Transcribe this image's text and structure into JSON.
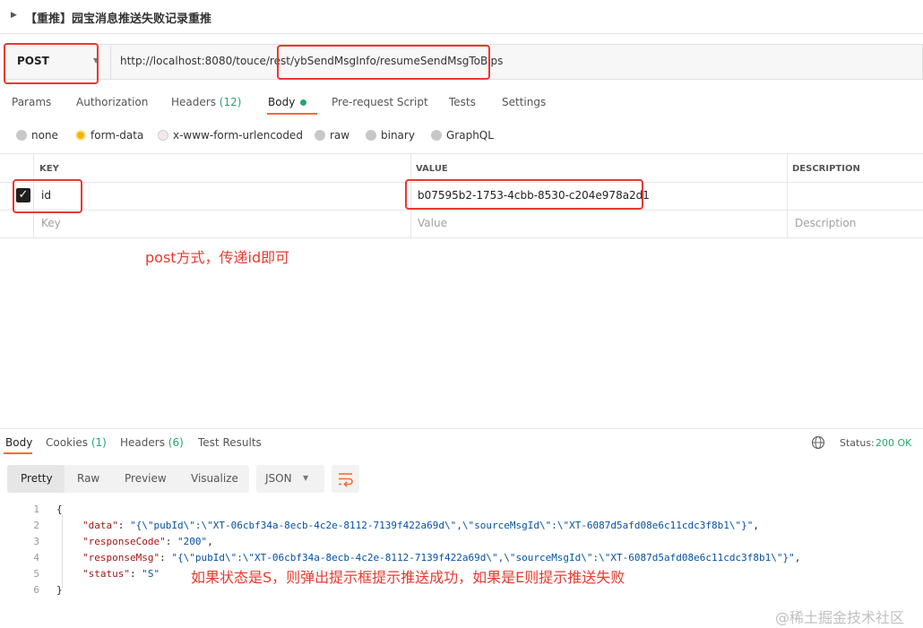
{
  "request": {
    "title": "【重推】园宝消息推送失败记录重推",
    "method": "POST",
    "url": "http://localhost:8080/touce/rest/ybSendMsgInfo/resumeSendMsgToBips"
  },
  "request_tabs": {
    "params": "Params",
    "authorization": "Authorization",
    "headers": "Headers",
    "headers_count": "(12)",
    "body": "Body",
    "prerequest": "Pre-request Script",
    "tests": "Tests",
    "settings": "Settings"
  },
  "body_types": {
    "none": "none",
    "form_data": "form-data",
    "urlencoded": "x-www-form-urlencoded",
    "raw": "raw",
    "binary": "binary",
    "graphql": "GraphQL",
    "selected": "form-data"
  },
  "params_table": {
    "headers": {
      "key": "KEY",
      "value": "VALUE",
      "description": "DESCRIPTION"
    },
    "row": {
      "key": "id",
      "value": "b07595b2-1753-4cbb-8530-c204e978a2d1",
      "checked": true
    },
    "placeholders": {
      "key": "Key",
      "value": "Value",
      "description": "Description"
    }
  },
  "annotations": {
    "post_note": "post方式，传递id即可",
    "status_note": "如果状态是S，则弹出提示框提示推送成功，如果是E则提示推送失败"
  },
  "response_tabs": {
    "body": "Body",
    "cookies": "Cookies",
    "cookies_count": "(1)",
    "headers": "Headers",
    "headers_count": "(6)",
    "test_results": "Test Results",
    "status_label": "Status:",
    "status_value": "200 OK"
  },
  "response_view": {
    "pretty": "Pretty",
    "raw": "Raw",
    "preview": "Preview",
    "visualize": "Visualize",
    "format": "JSON"
  },
  "response_body": {
    "line_numbers": [
      "1",
      "2",
      "3",
      "4",
      "5",
      "6"
    ],
    "open_brace": "{",
    "close_brace": "}",
    "data_key": "\"data\"",
    "data_value": "\"{\\\"pubId\\\":\\\"XT-06cbf34a-8ecb-4c2e-8112-7139f422a69d\\\",\\\"sourceMsgId\\\":\\\"XT-6087d5afd08e6c11cdc3f8b1\\\"}\"",
    "responseCode_key": "\"responseCode\"",
    "responseCode_value": "\"200\"",
    "responseMsg_key": "\"responseMsg\"",
    "responseMsg_value": "\"{\\\"pubId\\\":\\\"XT-06cbf34a-8ecb-4c2e-8112-7139f422a69d\\\",\\\"sourceMsgId\\\":\\\"XT-6087d5afd08e6c11cdc3f8b1\\\"}\"",
    "status_key": "\"status\"",
    "status_value": "\"S\""
  },
  "watermark": "@稀土掘金技术社区",
  "colors": {
    "accent_orange": "#f26b3a",
    "success_green": "#26a56c",
    "annotation_red": "#e8392f",
    "json_key": "#a31515",
    "json_string": "#0451a5"
  }
}
